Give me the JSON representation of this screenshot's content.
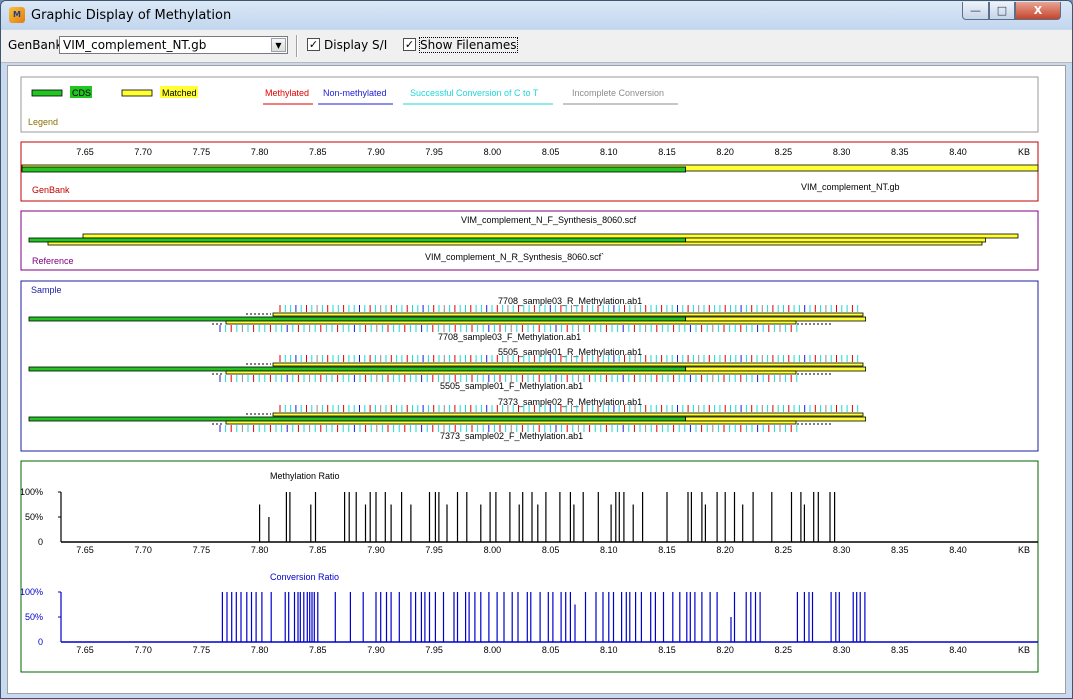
{
  "window": {
    "title": "Graphic Display of Methylation",
    "min_glyph": "—",
    "max_glyph": "□",
    "close_glyph": "X"
  },
  "toolbar": {
    "genbank_label": "GenBank",
    "genbank_file": "VIM_complement_NT.gb",
    "display_si_label": "Display S/I",
    "display_si_checked": true,
    "show_filenames_label": "Show Filenames",
    "show_filenames_checked": true
  },
  "legend": {
    "title": "Legend",
    "cds": "CDS",
    "matched": "Matched",
    "methylated": "Methylated",
    "non_methylated": "Non-methylated",
    "successful_conversion": "Successful Conversion of C to T",
    "incomplete_conversion": "Incomplete Conversion"
  },
  "colors": {
    "cds": "#22c522",
    "matched": "#ffff33",
    "methylated": "#e00000",
    "non_methylated": "#1c1cd6",
    "successful": "#1ed8d8",
    "incomplete": "#8c8c8c",
    "genbank_border": "#c00000",
    "reference_border": "#800080",
    "sample_border": "#1c1ca6",
    "ratio_border": "#006400",
    "conversion": "#0000cc"
  },
  "axis": {
    "ticks": [
      "7.65",
      "7.70",
      "7.75",
      "7.80",
      "7.85",
      "7.90",
      "7.95",
      "8.00",
      "8.05",
      "8.10",
      "8.15",
      "8.20",
      "8.25",
      "8.30",
      "8.35",
      "8.40"
    ],
    "unit": "KB"
  },
  "genbank": {
    "label": "GenBank",
    "file": "VIM_complement_NT.gb",
    "cds_end_kb": 8.166
  },
  "reference": {
    "label": "Reference",
    "forward_file": "VIM_complement_N_F_Synthesis_8060.scf",
    "reverse_file": "VIM_complement_N_R_Synthesis_8060.scf`"
  },
  "sample": {
    "label": "Sample",
    "tracks": [
      {
        "reverse_file": "7708_sample03_R_Methylation.ab1",
        "forward_file": "7708_sample03_F_Methylation.ab1"
      },
      {
        "reverse_file": "5505_sample01_R_Methylation.ab1",
        "forward_file": "5505_sample01_F_Methylation.ab1"
      },
      {
        "reverse_file": "7373_sample02_R_Methylation.ab1",
        "forward_file": "7373_sample02_F_Methylation.ab1"
      }
    ]
  },
  "chart_data": [
    {
      "type": "bar",
      "title": "Methylation Ratio",
      "xlabel": "KB",
      "y_ticks": [
        "100%",
        "50%",
        "0"
      ],
      "ylim": [
        0,
        1
      ],
      "xlim": [
        7.63,
        8.41
      ],
      "x": [
        7.8,
        7.808,
        7.823,
        7.826,
        7.844,
        7.848,
        7.873,
        7.877,
        7.883,
        7.891,
        7.895,
        7.9,
        7.908,
        7.913,
        7.922,
        7.93,
        7.946,
        7.951,
        7.954,
        7.961,
        7.97,
        7.978,
        7.99,
        7.998,
        8.003,
        8.015,
        8.023,
        8.026,
        8.034,
        8.039,
        8.046,
        8.058,
        8.067,
        8.07,
        8.078,
        8.091,
        8.102,
        8.106,
        8.109,
        8.113,
        8.121,
        8.129,
        8.15,
        8.168,
        8.171,
        8.18,
        8.183,
        8.193,
        8.2,
        8.208,
        8.215,
        8.224,
        8.24,
        8.257,
        8.265,
        8.268,
        8.276,
        8.28,
        8.29,
        8.294
      ],
      "values": [
        0.75,
        0.5,
        1,
        1,
        0.75,
        1,
        1,
        1,
        1,
        0.75,
        1,
        1,
        1,
        0.75,
        1,
        0.75,
        1,
        1,
        1,
        0.75,
        1,
        1,
        0.75,
        1,
        1,
        1,
        0.75,
        1,
        1,
        0.75,
        1,
        1,
        1,
        0.75,
        1,
        1,
        0.75,
        1,
        1,
        1,
        0.75,
        1,
        1,
        1,
        1,
        1,
        0.75,
        1,
        1,
        1,
        0.75,
        1,
        1,
        1,
        1,
        0.75,
        1,
        1,
        1,
        1
      ]
    },
    {
      "type": "bar",
      "title": "Conversion Ratio",
      "xlabel": "KB",
      "y_ticks": [
        "100%",
        "50%",
        "0"
      ],
      "ylim": [
        0,
        1
      ],
      "xlim": [
        7.63,
        8.41
      ],
      "x": [
        7.768,
        7.772,
        7.776,
        7.78,
        7.784,
        7.789,
        7.793,
        7.797,
        7.802,
        7.81,
        7.822,
        7.825,
        7.83,
        7.833,
        7.835,
        7.838,
        7.841,
        7.843,
        7.845,
        7.847,
        7.85,
        7.865,
        7.878,
        7.889,
        7.9,
        7.904,
        7.909,
        7.913,
        7.92,
        7.93,
        7.934,
        7.939,
        7.942,
        7.946,
        7.951,
        7.958,
        7.967,
        7.97,
        7.977,
        7.98,
        7.985,
        7.99,
        7.997,
        8.004,
        8.01,
        8.017,
        8.022,
        8.03,
        8.033,
        8.041,
        8.048,
        8.052,
        8.059,
        8.063,
        8.067,
        8.071,
        8.08,
        8.089,
        8.095,
        8.1,
        8.104,
        8.111,
        8.115,
        8.118,
        8.123,
        8.128,
        8.136,
        8.14,
        8.147,
        8.155,
        8.161,
        8.167,
        8.17,
        8.174,
        8.18,
        8.187,
        8.193,
        8.205,
        8.208,
        8.218,
        8.222,
        8.226,
        8.23,
        8.262,
        8.268,
        8.272,
        8.275,
        8.291,
        8.295,
        8.298,
        8.31,
        8.313,
        8.316,
        8.32
      ],
      "values": [
        1,
        1,
        1,
        1,
        1,
        1,
        1,
        1,
        1,
        1,
        1,
        1,
        1,
        1,
        1,
        1,
        1,
        1,
        1,
        1,
        1,
        1,
        1,
        1,
        1,
        1,
        1,
        1,
        1,
        1,
        1,
        1,
        1,
        1,
        1,
        1,
        1,
        1,
        1,
        1,
        1,
        1,
        1,
        1,
        1,
        1,
        1,
        1,
        1,
        1,
        1,
        1,
        1,
        1,
        1,
        0.75,
        1,
        1,
        1,
        1,
        1,
        1,
        1,
        1,
        1,
        1,
        1,
        1,
        1,
        1,
        1,
        1,
        1,
        1,
        1,
        1,
        1,
        0.5,
        1,
        1,
        1,
        1,
        1,
        1,
        1,
        1,
        1,
        1,
        1,
        1,
        1,
        1,
        1,
        1
      ]
    }
  ]
}
